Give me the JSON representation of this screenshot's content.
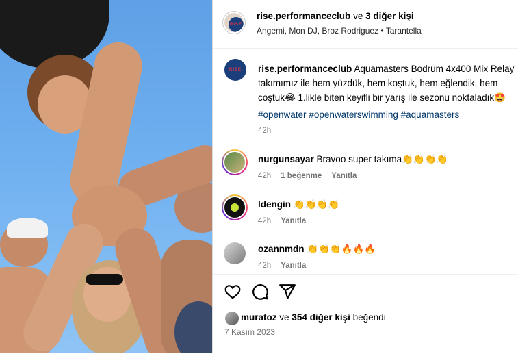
{
  "post": {
    "header": {
      "username": "rise.performanceclub",
      "connector": "ve",
      "others": "3 diğer kişi",
      "collaborators": "Angemi, Mon DJ, Broz Rodriguez",
      "separator": "•",
      "audio": "Tarantella"
    },
    "caption": {
      "username": "rise.performanceclub",
      "line1": "Aquamasters Bodrum 4x400 Mix Relay",
      "line2": "takımımız ile hem yüzdük, hem koştuk, hem eğlendik, hem",
      "line3": "coştuk😂 1.likle biten keyifli bir yarış ile sezonu noktaladık🤩",
      "hashtags": [
        "#openwater",
        "#openwaterswimming",
        "#aquamasters"
      ],
      "time": "42h"
    },
    "comments": [
      {
        "username": "nurgunsayar",
        "text": "Bravoo super takıma👏👏👏👏",
        "time": "42h",
        "likes": "1 beğenme",
        "reply": "Yanıtla"
      },
      {
        "username": "ldengin",
        "text": "👏👏👏👏",
        "time": "42h",
        "likes": "",
        "reply": "Yanıtla"
      },
      {
        "username": "ozannmdn",
        "text": "👏👏👏🔥🔥🔥",
        "time": "42h",
        "likes": "",
        "reply": "Yanıtla"
      }
    ],
    "likes": {
      "user": "muratoz",
      "connector": "ve",
      "count": "354 diğer kişi",
      "suffix": "beğendi"
    },
    "date": "7 Kasım 2023",
    "brand_avatar_text": "RISE",
    "icons": [
      "heart-icon",
      "comment-icon",
      "share-icon"
    ],
    "colors": {
      "brand": "#1b3f7a",
      "brand_text": "#e6334a",
      "hashtag": "#00376b",
      "meta": "#737373"
    }
  }
}
